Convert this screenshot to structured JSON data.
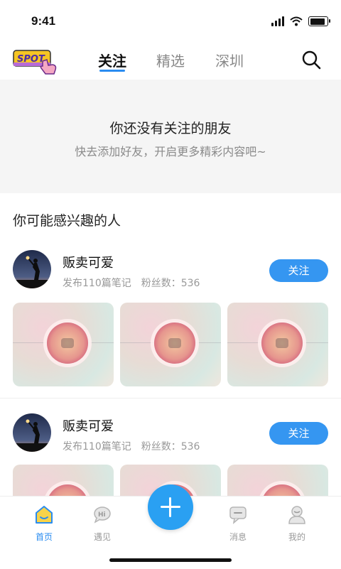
{
  "status_bar": {
    "time": "9:41"
  },
  "header": {
    "logo_text": "SPOT",
    "tabs": [
      {
        "label": "关注",
        "active": true
      },
      {
        "label": "精选",
        "active": false
      },
      {
        "label": "深圳",
        "active": false
      }
    ]
  },
  "empty_state": {
    "title": "你还没有关注的朋友",
    "subtitle": "快去添加好友，开启更多精彩内容吧~"
  },
  "recommend": {
    "section_title": "你可能感兴趣的人",
    "users": [
      {
        "name": "贩卖可爱",
        "posts": "发布110篇笔记",
        "fans": "粉丝数：536",
        "follow_label": "关注"
      },
      {
        "name": "贩卖可爱",
        "posts": "发布110篇笔记",
        "fans": "粉丝数：536",
        "follow_label": "关注"
      }
    ]
  },
  "bottom_nav": {
    "items": [
      {
        "label": "首页",
        "icon": "home-icon",
        "active": true
      },
      {
        "label": "遇见",
        "icon": "hi-bubble-icon",
        "active": false
      },
      {
        "label": "消息",
        "icon": "message-icon",
        "active": false
      },
      {
        "label": "我的",
        "icon": "profile-icon",
        "active": false
      }
    ]
  },
  "colors": {
    "accent": "#2a8cf0",
    "follow_button": "#3596f1",
    "fab": "#2aa0f2"
  }
}
